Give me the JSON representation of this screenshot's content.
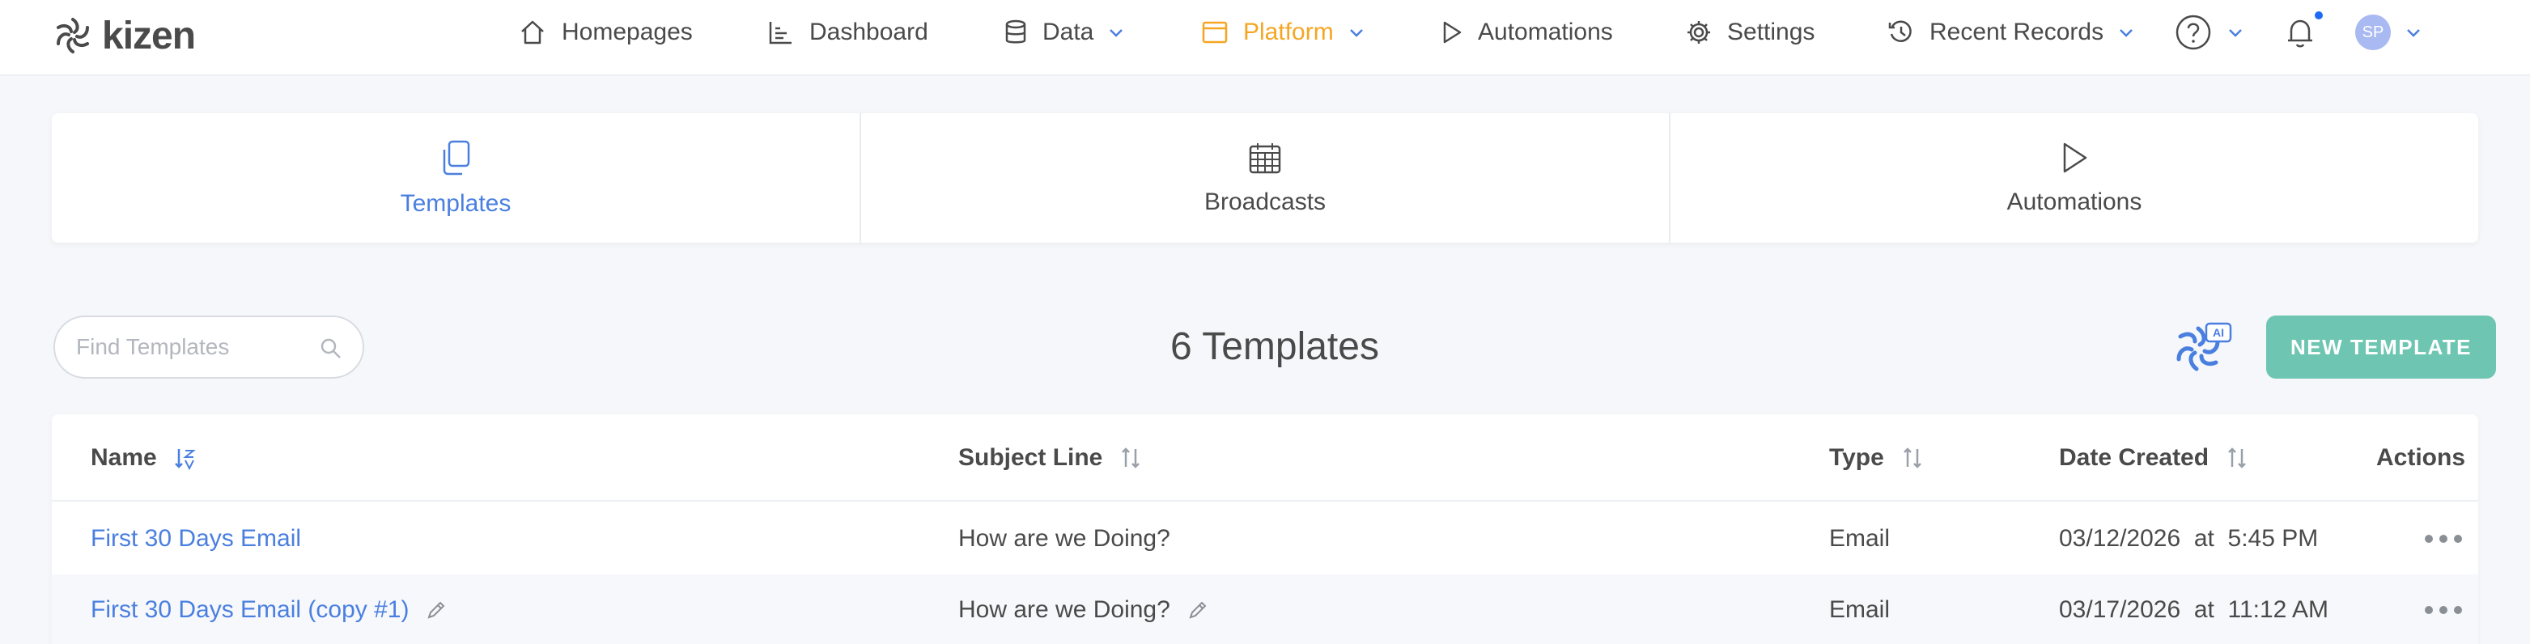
{
  "brand": {
    "name": "kizen"
  },
  "nav": {
    "items": [
      {
        "label": "Homepages",
        "icon": "home-icon"
      },
      {
        "label": "Dashboard",
        "icon": "bar-chart-icon"
      },
      {
        "label": "Data",
        "icon": "database-icon"
      },
      {
        "label": "Platform",
        "icon": "window-icon"
      },
      {
        "label": "Automations",
        "icon": "play-icon"
      },
      {
        "label": "Settings",
        "icon": "gear-icon"
      },
      {
        "label": "Recent Records",
        "icon": "history-icon"
      }
    ],
    "help_icon": "question-icon",
    "notification_icon": "bell-icon",
    "avatar_initials": "SP",
    "active_color": "#f5a623"
  },
  "tabs": [
    {
      "label": "Templates",
      "icon": "copy-icon",
      "active": true
    },
    {
      "label": "Broadcasts",
      "icon": "calendar-icon",
      "active": false
    },
    {
      "label": "Automations",
      "icon": "play-icon",
      "active": false
    }
  ],
  "search": {
    "placeholder": "Find Templates",
    "value": ""
  },
  "count_title": "6 Templates",
  "ai_button": {
    "label": "AI"
  },
  "new_button": {
    "label": "NEW TEMPLATE",
    "color": "#6ec6b2"
  },
  "table": {
    "columns": [
      "Name",
      "Subject Line",
      "Type",
      "Date Created",
      "Actions"
    ],
    "rows": [
      {
        "name": "First 30 Days Email",
        "subject": "How are we Doing?",
        "type": "Email",
        "date": "03/12/2026  at  5:45 PM",
        "editable": false
      },
      {
        "name": "First 30 Days Email (copy #1)",
        "subject": "How are we Doing?",
        "type": "Email",
        "date": "03/17/2026  at  11:12 AM",
        "editable": true
      }
    ]
  },
  "accent_color": "#4a7fe0"
}
